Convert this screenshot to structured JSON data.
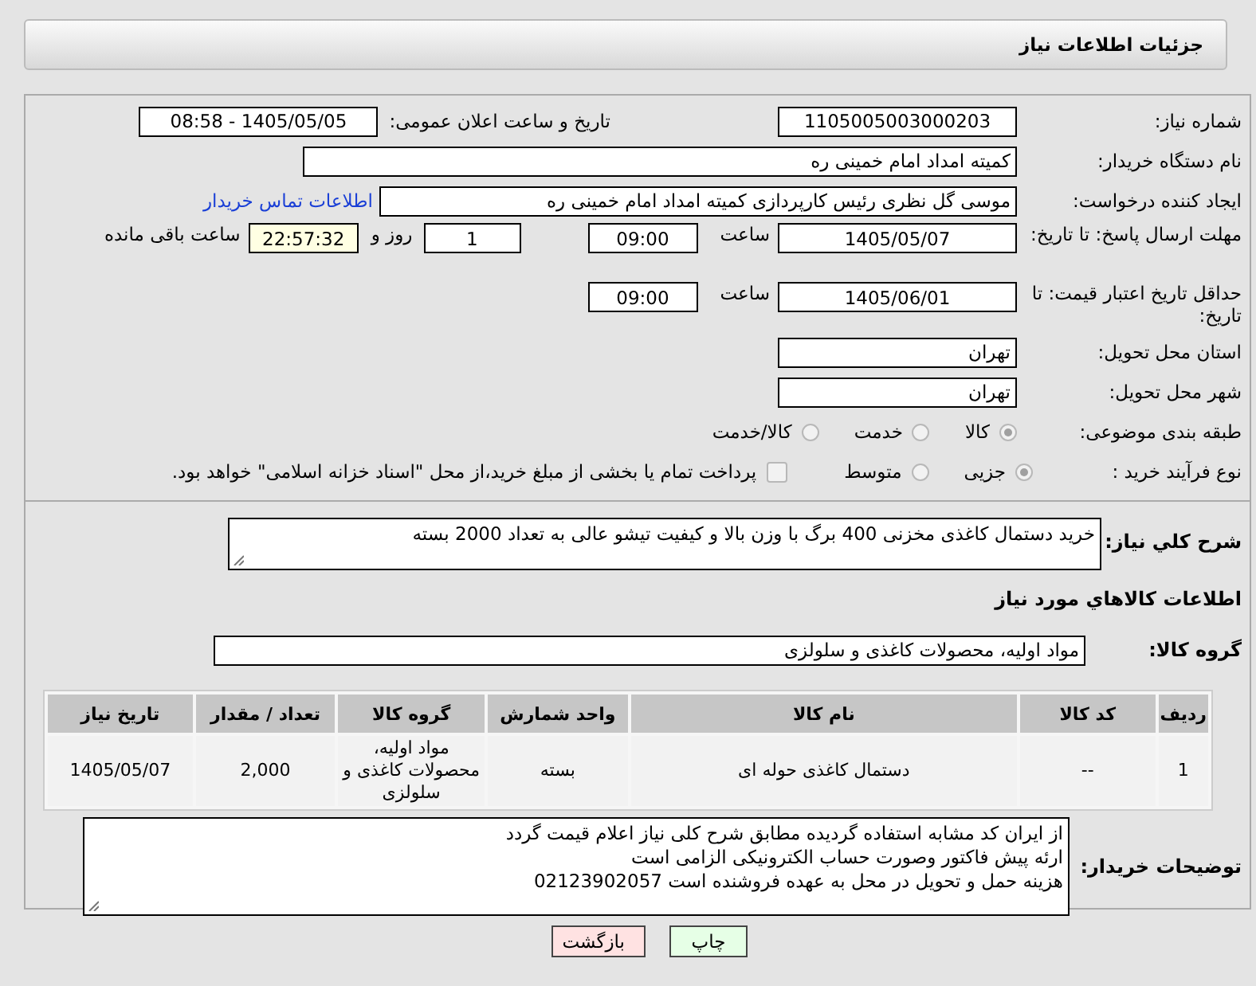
{
  "header": {
    "title": "جزئیات اطلاعات نیاز"
  },
  "need_number": {
    "label": "شماره نیاز:",
    "value": "1105005003000203"
  },
  "announce": {
    "label": "تاریخ و ساعت اعلان عمومی:",
    "value": "1405/05/05 - 08:58"
  },
  "buyer_org": {
    "label": "نام دستگاه خریدار:",
    "value": "کمیته امداد امام خمینی ره"
  },
  "requester": {
    "label": "ایجاد کننده درخواست:",
    "value": "موسی گل نظری رئیس کارپردازی کمیته امداد امام خمینی ره",
    "link": "اطلاعات تماس خریدار"
  },
  "response_deadline": {
    "label": "مهلت ارسال پاسخ: تا تاریخ:",
    "date": "1405/05/07",
    "time_label": "ساعت",
    "time": "09:00",
    "days": "1",
    "days_label": "روز و",
    "remaining": "22:57:32",
    "remaining_label": "ساعت باقی مانده"
  },
  "price_validity": {
    "label": "حداقل تاریخ اعتبار قیمت: تا تاریخ:",
    "date": "1405/06/01",
    "time_label": "ساعت",
    "time": "09:00"
  },
  "province": {
    "label": "استان محل تحویل:",
    "value": "تهران"
  },
  "city": {
    "label": "شهر محل تحویل:",
    "value": "تهران"
  },
  "category": {
    "label": "طبقه بندی موضوعی:",
    "options": [
      {
        "label": "کالا",
        "selected": true
      },
      {
        "label": "خدمت",
        "selected": false
      },
      {
        "label": "کالا/خدمت",
        "selected": false
      }
    ]
  },
  "process": {
    "label": "نوع فرآیند خرید :",
    "options": [
      {
        "label": "جزیی",
        "selected": true
      },
      {
        "label": "متوسط",
        "selected": false
      }
    ],
    "payment": {
      "checked": false,
      "label": "پرداخت تمام یا بخشی از مبلغ خرید،از محل \"اسناد خزانه اسلامی\" خواهد بود."
    }
  },
  "description": {
    "label": "شرح کلي نياز:",
    "value": "خرید دستمال کاغذی مخزنی 400 برگ با وزن بالا و کیفیت تیشو عالی به تعداد 2000 بسته"
  },
  "items_heading": "اطلاعات کالاهاي مورد نياز",
  "goods_group": {
    "label": "گروه کالا:",
    "value": "مواد اولیه، محصولات کاغذی و سلولزی"
  },
  "table": {
    "columns": [
      "ردیف",
      "کد کالا",
      "نام کالا",
      "واحد شمارش",
      "گروه کالا",
      "تعداد / مقدار",
      "تاریخ نیاز"
    ],
    "rows": [
      [
        "1",
        "--",
        "دستمال کاغذی حوله ای",
        "بسته",
        "مواد اولیه، محصولات کاغذی و سلولزی",
        "2,000",
        "1405/05/07"
      ]
    ]
  },
  "notes": {
    "label": "توضیحات خریدار:",
    "value": "از ایران کد مشابه استفاده گردیده مطابق شرح کلی نیاز اعلام قیمت گردد\nارئه پیش فاکتور وصورت حساب الکترونیکی الزامی است\nهزینه حمل و تحویل در محل به عهده فروشنده است 02123902057"
  },
  "buttons": [
    {
      "label": "چاپ",
      "kind": "print"
    },
    {
      "label": "بازگشت",
      "kind": "back"
    }
  ]
}
